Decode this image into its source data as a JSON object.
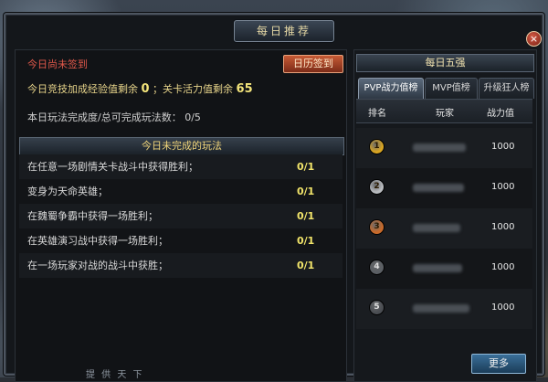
{
  "window": {
    "title": "每日推荐",
    "close_label": "×"
  },
  "left": {
    "signin_status": "今日尚未签到",
    "calendar_button": "日历签到",
    "exp_prefix": "今日竞技加成经验值剩余",
    "exp_value": "0",
    "activity_prefix": "；关卡活力值剩余",
    "activity_value": "65",
    "completion_label": "本日玩法完成度/总可完成玩法数：",
    "completion_value": "0/5",
    "section_title": "今日未完成的玩法",
    "tasks": [
      {
        "label": "在任意一场剧情关卡战斗中获得胜利；",
        "progress": "0/1"
      },
      {
        "label": "变身为天命英雄；",
        "progress": "0/1"
      },
      {
        "label": "在魏蜀争霸中获得一场胜利；",
        "progress": "0/1"
      },
      {
        "label": "在英雄演习战中获得一场胜利；",
        "progress": "0/1"
      },
      {
        "label": "在一场玩家对战的战斗中获胜；",
        "progress": "0/1"
      }
    ]
  },
  "right": {
    "header": "每日五强",
    "tabs": [
      {
        "label": "PVP战力值榜",
        "active": true
      },
      {
        "label": "MVP值榜",
        "active": false
      },
      {
        "label": "升级狂人榜",
        "active": false
      }
    ],
    "columns": {
      "rank": "排名",
      "player": "玩家",
      "power": "战力值"
    },
    "rows": [
      {
        "rank": "1",
        "power": "1000",
        "medal_color": "#d9a521"
      },
      {
        "rank": "2",
        "power": "1000",
        "medal_color": "#b9bcc0"
      },
      {
        "rank": "3",
        "power": "1000",
        "medal_color": "#c96a2a"
      },
      {
        "rank": "4",
        "power": "1000",
        "medal_color": "#5b5f64"
      },
      {
        "rank": "5",
        "power": "1000",
        "medal_color": "#4a4d52"
      }
    ],
    "more_button": "更多"
  },
  "footer": {
    "text": "提 供 天 下"
  },
  "colors": {
    "accent_gold": "#f1e46a",
    "status_red": "#e0584a",
    "header_gold": "#f0d57a"
  }
}
